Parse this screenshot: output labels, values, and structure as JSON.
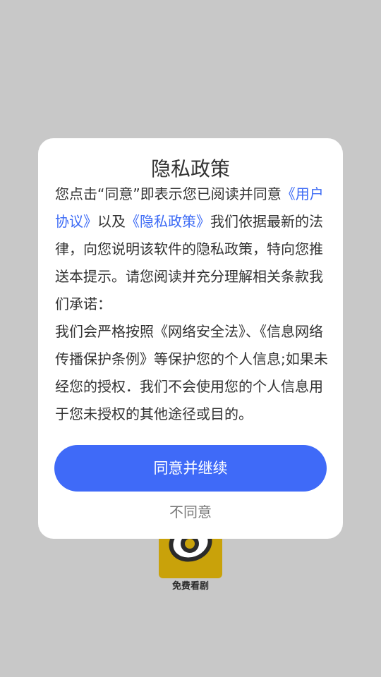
{
  "colors": {
    "background": "#c8c8c8",
    "dialog": "#ffffff",
    "accent": "#3f6af8",
    "link": "#3d6bf5",
    "text": "#333333",
    "muted": "#777777",
    "logo": "#c9a20a"
  },
  "splash": {
    "logo_icon": "eye-logo-icon",
    "app_name": "免费看剧"
  },
  "dialog": {
    "title": "隐私政策",
    "para1_pre": "您点击“同意”即表示您已阅读并同意",
    "link_user_agreement": "《用户协议》",
    "para1_mid": "以及",
    "link_privacy_policy": "《隐私政策》",
    "para1_post": "我们依据最新的法律，向您说明该软件的隐私政策，特向您推送本提示。请您阅读并充分理解相关条款我们承诺：",
    "para2": "我们会严格按照《网络安全法》、《信息网络传播保护条例》等保护您的个人信息;如果未经您的授权．我们不会使用您的个人信息用于您未授权的其他途径或目的。",
    "agree_label": "同意并继续",
    "disagree_label": "不同意"
  }
}
